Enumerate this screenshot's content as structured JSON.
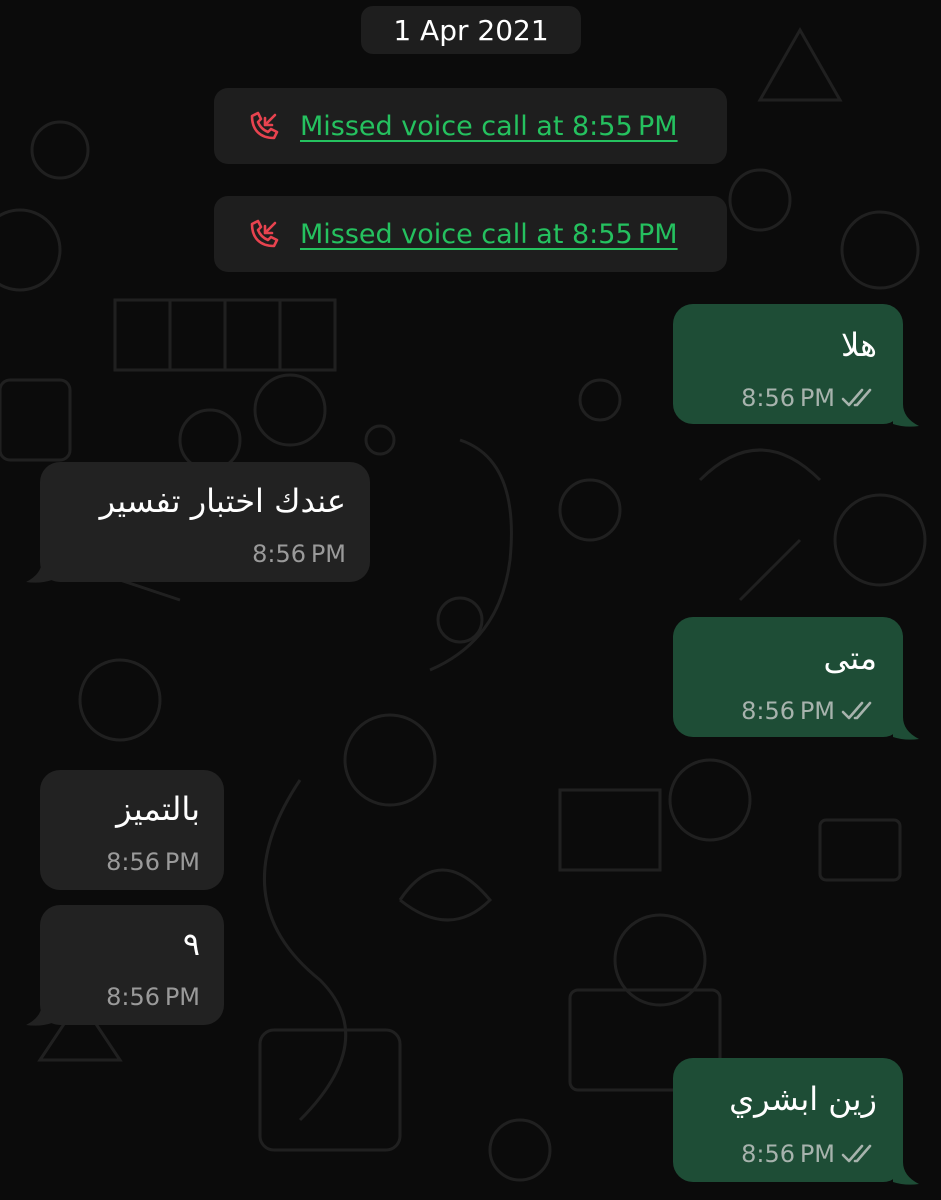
{
  "chat": {
    "date_chip": "1 Apr 2021",
    "missed_calls": [
      {
        "text": "Missed voice call at 8:55 PM"
      },
      {
        "text": "Missed voice call at 8:55 PM"
      }
    ],
    "messages": [
      {
        "direction": "outgoing",
        "text": "هلا",
        "time": "8:56 PM",
        "status": "read"
      },
      {
        "direction": "incoming",
        "text": "عندك اختبار تفسير",
        "time": "8:56 PM"
      },
      {
        "direction": "outgoing",
        "text": "متى",
        "time": "8:56 PM",
        "status": "read"
      },
      {
        "direction": "incoming",
        "text": "بالتميز",
        "time": "8:56 PM"
      },
      {
        "direction": "incoming",
        "text": "٩",
        "time": "8:56 PM"
      },
      {
        "direction": "outgoing",
        "text": "زين ابشري",
        "time": "8:56 PM",
        "status": "read"
      }
    ]
  },
  "colors": {
    "background": "#0b0b0b",
    "outgoing_bubble": "#1e4d36",
    "incoming_bubble": "#222222",
    "missed_call_text": "#25c15f",
    "missed_call_icon": "#e8434f"
  },
  "icons": {
    "missed_call": "missed-call-icon",
    "read_receipt": "double-check-icon"
  }
}
